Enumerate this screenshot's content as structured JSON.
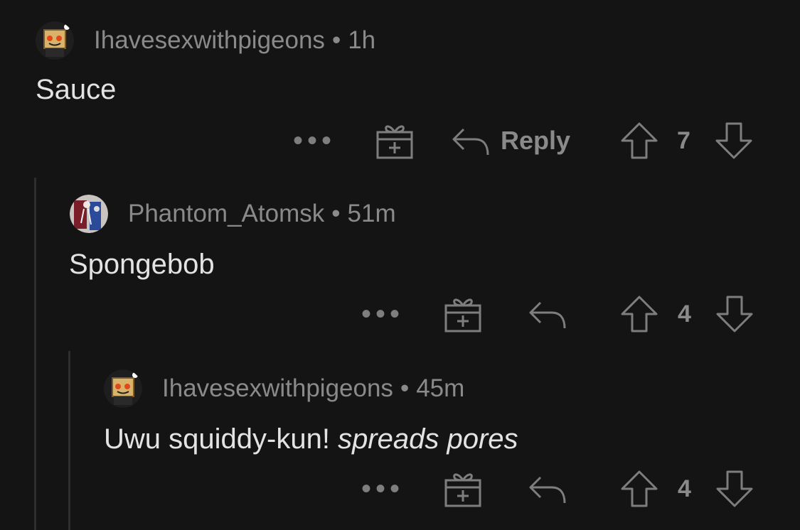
{
  "comments": [
    {
      "username": "Ihavesexwithpigeons",
      "separator": "•",
      "time": "1h",
      "text": "Sauce",
      "reply_label": "Reply",
      "more_label": "•••",
      "score": "7",
      "avatar_icon": "snoo-box-avatar"
    },
    {
      "username": "Phantom_Atomsk",
      "separator": "•",
      "time": "51m",
      "text": "Spongebob",
      "more_label": "•••",
      "score": "4",
      "avatar_icon": "anime-figure-avatar"
    },
    {
      "username": "Ihavesexwithpigeons",
      "separator": "•",
      "time": "45m",
      "text_plain": "Uwu squiddy-kun!",
      "text_italic": "spreads pores",
      "more_label": "•••",
      "score": "4",
      "avatar_icon": "snoo-box-avatar"
    }
  ],
  "colors": {
    "background": "#141414",
    "text": "#e3e3e3",
    "muted": "#8a8a8a",
    "thread_line": "#2e2e2e"
  }
}
